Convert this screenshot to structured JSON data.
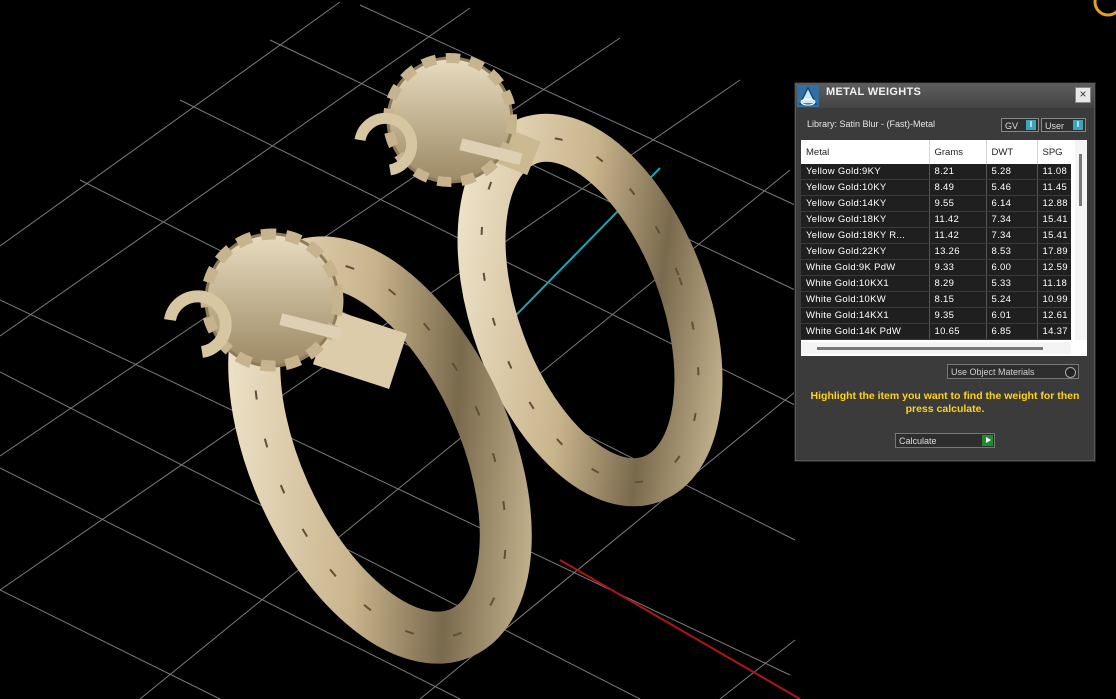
{
  "window": {
    "title": "METAL WEIGHTS",
    "close_icon": "close-icon",
    "app_icon": "metal-weights-app-icon"
  },
  "library": {
    "label": "Library: Satin Blur - (Fast)-Metal",
    "gv_label": "GV",
    "user_label": "User",
    "toggle_glyph": "I"
  },
  "table": {
    "columns": [
      "Metal",
      "Grams",
      "DWT",
      "SPG"
    ],
    "rows": [
      [
        "Yellow Gold:9KY",
        "8.21",
        "5.28",
        "11.08"
      ],
      [
        "Yellow Gold:10KY",
        "8.49",
        "5.46",
        "11.45"
      ],
      [
        "Yellow Gold:14KY",
        "9.55",
        "6.14",
        "12.88"
      ],
      [
        "Yellow Gold:18KY",
        "11.42",
        "7.34",
        "15.41"
      ],
      [
        "Yellow Gold:18KY R...",
        "11.42",
        "7.34",
        "15.41"
      ],
      [
        "Yellow Gold:22KY",
        "13.26",
        "8.53",
        "17.89"
      ],
      [
        "White Gold:9K PdW",
        "9.33",
        "6.00",
        "12.59"
      ],
      [
        "White Gold:10KX1",
        "8.29",
        "5.33",
        "11.18"
      ],
      [
        "White Gold:10KW",
        "8.15",
        "5.24",
        "10.99"
      ],
      [
        "White Gold:14KX1",
        "9.35",
        "6.01",
        "12.61"
      ],
      [
        "White Gold:14K PdW",
        "10.65",
        "6.85",
        "14.37"
      ]
    ]
  },
  "use_object_materials": {
    "label": "Use Object Materials",
    "selected": false
  },
  "instruction": "Highlight the item you want to find the weight for then press calculate.",
  "calculate": {
    "label": "Calculate",
    "icon": "play-icon"
  },
  "scene": {
    "background": "#000000",
    "grid_color": "#7a7a7a",
    "metal_color": "#d8c7a4",
    "x_axis_color": "#b01515",
    "z_axis_color": "#18a6b8",
    "object": "hoop-earrings-with-flower-backs"
  },
  "colors": {
    "panel_bg": "#3b3b3b",
    "accent_text": "#ffd21e",
    "toggle_accent": "#3aa6b8",
    "play_green": "#1f8a2e"
  }
}
